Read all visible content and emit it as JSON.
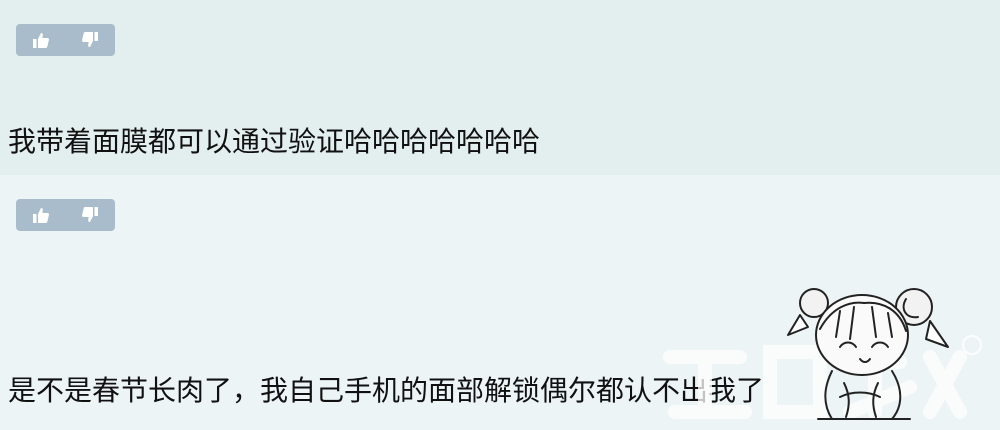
{
  "comments": [
    {
      "text": "我带着面膜都可以通过验证哈哈哈哈哈哈哈"
    },
    {
      "text": "是不是春节长肉了，我自己手机的面部解锁偶尔都认不出我了"
    }
  ],
  "icons": {
    "like": "thumbs-up-icon",
    "dislike": "thumbs-down-icon"
  },
  "colors": {
    "vote_bg": "#a9bccb",
    "comment1_bg": "#e3eeee",
    "comment2_bg": "#edf4f6"
  }
}
